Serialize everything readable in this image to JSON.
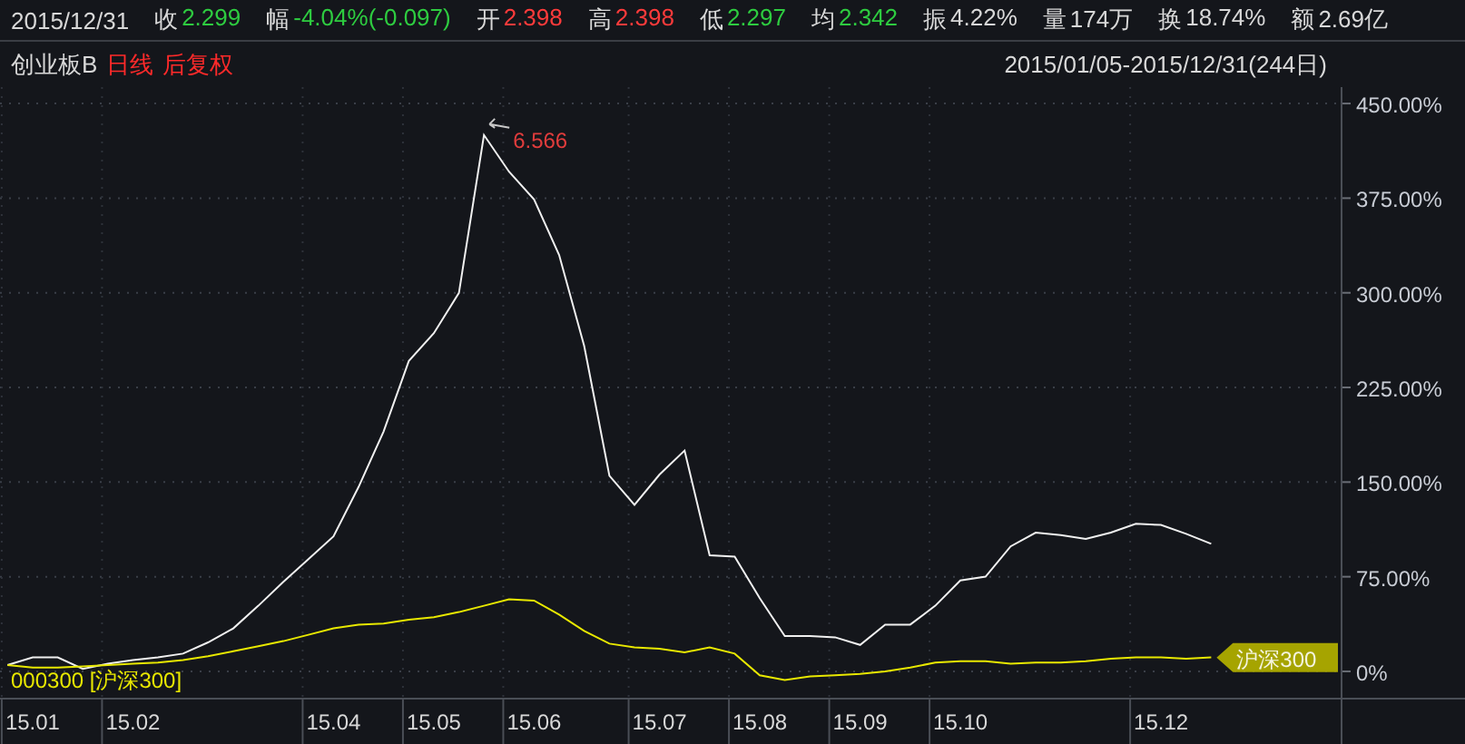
{
  "quote_bar": {
    "date": "2015/12/31",
    "fields": [
      {
        "label": "收",
        "value": "2.299",
        "color": "#2ecc40"
      },
      {
        "label": "幅",
        "value": "-4.04%(-0.097)",
        "color": "#2ecc40"
      },
      {
        "label": "开",
        "value": "2.398",
        "color": "#ff3b3b"
      },
      {
        "label": "高",
        "value": "2.398",
        "color": "#ff3b3b"
      },
      {
        "label": "低",
        "value": "2.297",
        "color": "#2ecc40"
      },
      {
        "label": "均",
        "value": "2.342",
        "color": "#2ecc40"
      },
      {
        "label": "振",
        "value": "4.22%",
        "color": "#d8d8d8"
      },
      {
        "label": "量",
        "value": "174万",
        "color": "#d8d8d8"
      },
      {
        "label": "换",
        "value": "18.74%",
        "color": "#d8d8d8"
      },
      {
        "label": "额",
        "value": "2.69亿",
        "color": "#d8d8d8"
      }
    ]
  },
  "chart_header": {
    "period": "日线",
    "adjust": "后复权",
    "range": "2015/01/05-2015/12/31(244日)"
  },
  "series_tag": {
    "text": "沪深300"
  },
  "chart_data": {
    "type": "line",
    "ylim": [
      -21.6,
      463
    ],
    "grid": true,
    "categories": [
      null,
      "15.01",
      null,
      null,
      null,
      "15.02",
      null,
      null,
      null,
      null,
      null,
      null,
      null,
      "15.04",
      null,
      null,
      null,
      "15.05",
      null,
      null,
      null,
      "15.06",
      null,
      null,
      null,
      null,
      "15.07",
      null,
      null,
      null,
      "15.08",
      null,
      null,
      null,
      "15.09",
      null,
      null,
      null,
      "15.10",
      null,
      null,
      null,
      null,
      null,
      null,
      null,
      "15.12",
      null,
      null
    ],
    "yticks": [
      {
        "value": 0,
        "label": "0%"
      },
      {
        "value": 75,
        "label": "75.00%"
      },
      {
        "value": 150,
        "label": "150.00%"
      },
      {
        "value": 225,
        "label": "225.00%"
      },
      {
        "value": 300,
        "label": "300.00%"
      },
      {
        "value": 375,
        "label": "375.00%"
      },
      {
        "value": 450,
        "label": "450.00%"
      }
    ],
    "series": [
      {
        "name": "创业板B",
        "color": "#f0f0f0",
        "values": [
          5,
          11,
          11,
          2,
          6,
          9,
          11,
          14,
          23,
          34,
          52,
          71,
          89,
          107,
          146,
          190,
          246,
          268,
          300,
          425,
          396,
          374,
          330,
          258,
          155,
          132,
          156,
          175,
          92,
          91,
          58,
          28,
          28,
          27,
          21,
          37,
          37,
          52,
          72,
          75,
          99,
          110,
          108,
          105,
          110,
          117,
          116,
          109,
          101
        ]
      },
      {
        "name": "000300 [沪深300]",
        "color": "#e8e800",
        "values": [
          5,
          3,
          3,
          4,
          5,
          6,
          7,
          9,
          12,
          16,
          20,
          24,
          29,
          34,
          37,
          38,
          41,
          43,
          47,
          52,
          57,
          56,
          45,
          32,
          22,
          19,
          18,
          15,
          19,
          14,
          -3,
          -7,
          -4,
          -3,
          -2,
          0,
          3,
          7,
          8,
          8,
          6,
          7,
          7,
          8,
          10,
          11,
          11,
          10,
          11
        ]
      }
    ],
    "annotations": [
      "6.566"
    ]
  }
}
